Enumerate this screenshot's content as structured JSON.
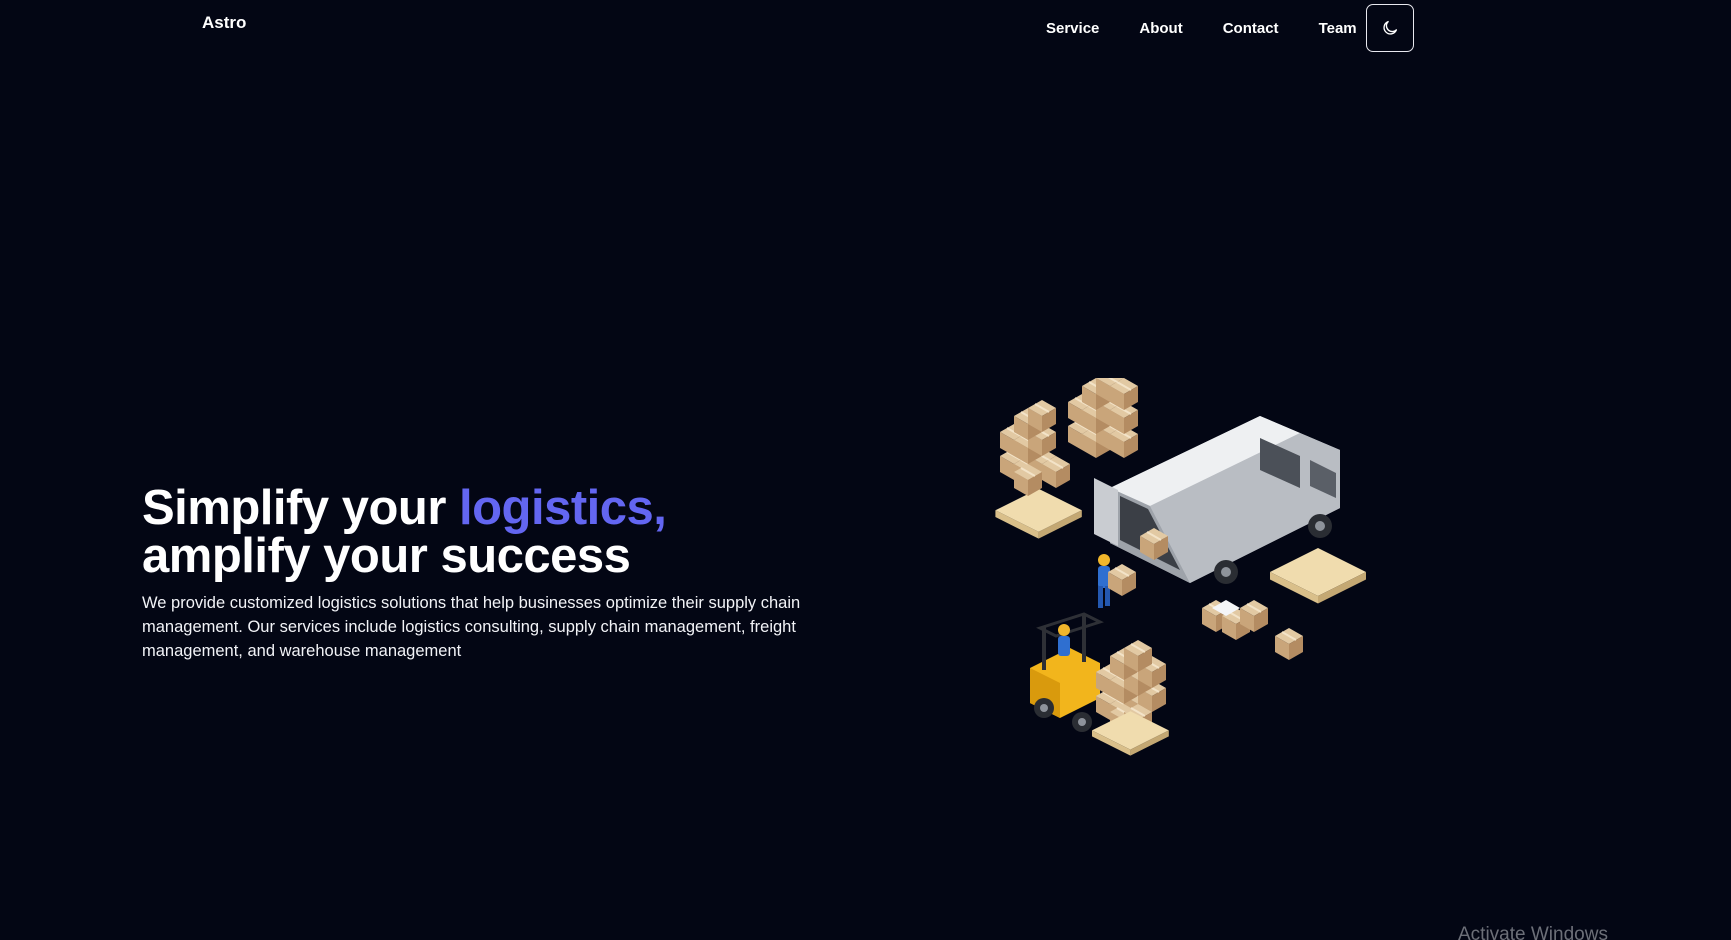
{
  "header": {
    "brand": "Astro",
    "nav": [
      {
        "label": "Service"
      },
      {
        "label": "About"
      },
      {
        "label": "Contact"
      },
      {
        "label": "Team"
      }
    ],
    "theme_toggle_icon": "moon-icon"
  },
  "hero": {
    "title_part1": "Simplify your ",
    "title_accent": "logistics,",
    "title_part2": "amplify your success",
    "description": "We provide customized logistics solutions that help businesses optimize their supply chain management. Our services include logistics consulting, supply chain management, freight management, and warehouse management",
    "accent_color": "#6366f1"
  },
  "illustration": {
    "subject": "delivery van with boxes, pallets, worker and forklift"
  },
  "watermark": "Activate Windows",
  "colors": {
    "background": "#030614",
    "text": "#ffffff",
    "accent": "#6366f1"
  }
}
